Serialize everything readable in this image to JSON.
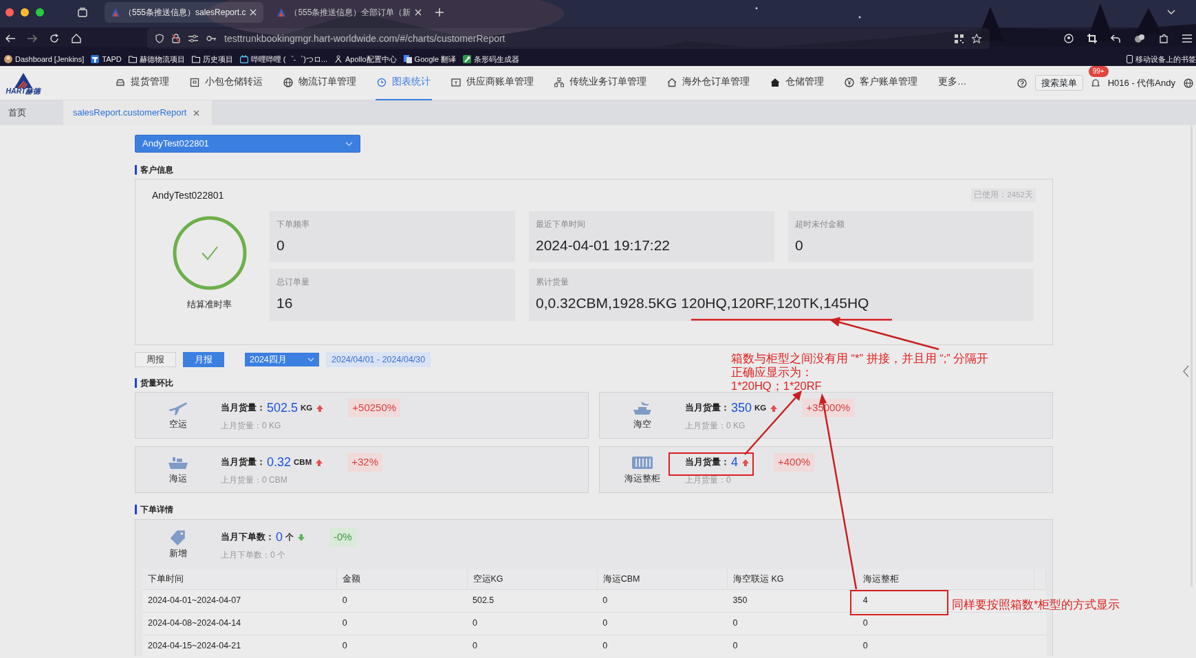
{
  "browser": {
    "tabs": [
      {
        "title": "（555条推送信息）salesReport.c",
        "selected": true
      },
      {
        "title": "（555条推送信息）全部订单（新",
        "selected": false
      }
    ],
    "url": "testtrunkbookingmgr.hart-worldwide.com/#/charts/customerReport",
    "bookmarks": [
      {
        "label": "Dashboard [Jenkins]",
        "kind": "avatar"
      },
      {
        "label": "TAPD",
        "kind": "app"
      },
      {
        "label": "赫德物流项目",
        "kind": "folder"
      },
      {
        "label": "历史项目",
        "kind": "folder"
      },
      {
        "label": "哔哩哔哩 (゜-゜)つロ...",
        "kind": "tv"
      },
      {
        "label": "Apollo配置中心",
        "kind": "apollo"
      },
      {
        "label": "Google 翻译",
        "kind": "translate"
      },
      {
        "label": "条形码生成器",
        "kind": "wrench"
      }
    ],
    "mobile_bookmarks": "移动设备上的书签"
  },
  "app": {
    "logo_caption": "HART赫德",
    "nav": [
      {
        "label": "提货管理",
        "kind": "car",
        "selected": false
      },
      {
        "label": "小包仓储转运",
        "kind": "package",
        "selected": false
      },
      {
        "label": "物流订单管理",
        "kind": "globe",
        "selected": false
      },
      {
        "label": "图表统计",
        "kind": "clock",
        "selected": true
      },
      {
        "label": "供应商账单管理",
        "kind": "bill",
        "selected": false
      },
      {
        "label": "传统业务订单管理",
        "kind": "tree",
        "selected": false
      },
      {
        "label": "海外仓订单管理",
        "kind": "house",
        "selected": false
      },
      {
        "label": "仓储管理",
        "kind": "house_solid",
        "selected": false
      },
      {
        "label": "客户账单管理",
        "kind": "yen",
        "selected": false
      },
      {
        "label": "更多…",
        "selected": false
      }
    ],
    "search_menu": "搜索菜单",
    "notification_badge": "99+",
    "user": "H016 - 代伟Andy"
  },
  "page_tabs": [
    {
      "label": "首页",
      "selected": false,
      "closable": false
    },
    {
      "label": "salesReport.customerReport",
      "selected": true,
      "closable": true
    }
  ],
  "customer_select": "AndyTest022801",
  "customer_info": {
    "title": "客户信息",
    "name": "AndyTest022801",
    "used": "已使用：2452天",
    "rate_label": "结算准时率",
    "stats": [
      {
        "label": "下单频率",
        "value": "0"
      },
      {
        "label": "最近下单时间",
        "value": "2024-04-01 19:17:22"
      },
      {
        "label": "超时未付金额",
        "value": "0"
      },
      {
        "label": "总订单量",
        "value": "16"
      },
      {
        "label": "累计货量",
        "value": "0,0.32CBM,1928.5KG 120HQ,120RF,120TK,145HQ"
      }
    ]
  },
  "period": {
    "buttons": [
      {
        "label": "周报",
        "selected": false
      },
      {
        "label": "月报",
        "selected": true
      }
    ],
    "month": "2024四月",
    "range": "2024/04/01 - 2024/04/30"
  },
  "volume": {
    "title": "货量环比",
    "cards": [
      {
        "label": "空运",
        "kind": "air",
        "current_label": "当月货量：",
        "value": "502.5",
        "unit": "KG",
        "increase": true,
        "change": "+50250%",
        "previous": "上月货量：0 KG"
      },
      {
        "label": "海空",
        "kind": "sea_air",
        "current_label": "当月货量：",
        "value": "350",
        "unit": "KG",
        "increase": true,
        "change": "+35000%",
        "previous": "上月货量：0 KG"
      },
      {
        "label": "海运",
        "kind": "sea",
        "current_label": "当月货量：",
        "value": "0.32",
        "unit": "CBM",
        "increase": true,
        "change": "+32%",
        "previous": "上月货量：0 CBM"
      },
      {
        "label": "海运整柜",
        "kind": "container",
        "current_label": "当月货量：",
        "value": "4",
        "increase": true,
        "change": "+400%",
        "previous": "上月货量：0"
      }
    ]
  },
  "orders": {
    "title": "下单详情",
    "summary": {
      "label": "新增",
      "current_label": "当月下单数：",
      "value": "0",
      "unit": "个",
      "increase": false,
      "change": "-0%",
      "previous": "上月下单数：0 个"
    },
    "columns": [
      "下单时间",
      "金额",
      "空运KG",
      "海运CBM",
      "海空联运 KG",
      "海运整柜"
    ],
    "rows": [
      [
        "2024-04-01~2024-04-07",
        "0",
        "502.5",
        "0",
        "350",
        "4"
      ],
      [
        "2024-04-08~2024-04-14",
        "0",
        "0",
        "0",
        "0",
        "0"
      ],
      [
        "2024-04-15~2024-04-21",
        "0",
        "0",
        "0",
        "0",
        "0"
      ]
    ]
  },
  "annotations": {
    "note_lines": [
      "箱数与柜型之间没有用 “*” 拼接，并且用 “;” 分隔开",
      "正确应显示为：",
      "1*20HQ；1*20RF"
    ],
    "table_note": "同样要按照箱数*柜型的方式显示"
  }
}
